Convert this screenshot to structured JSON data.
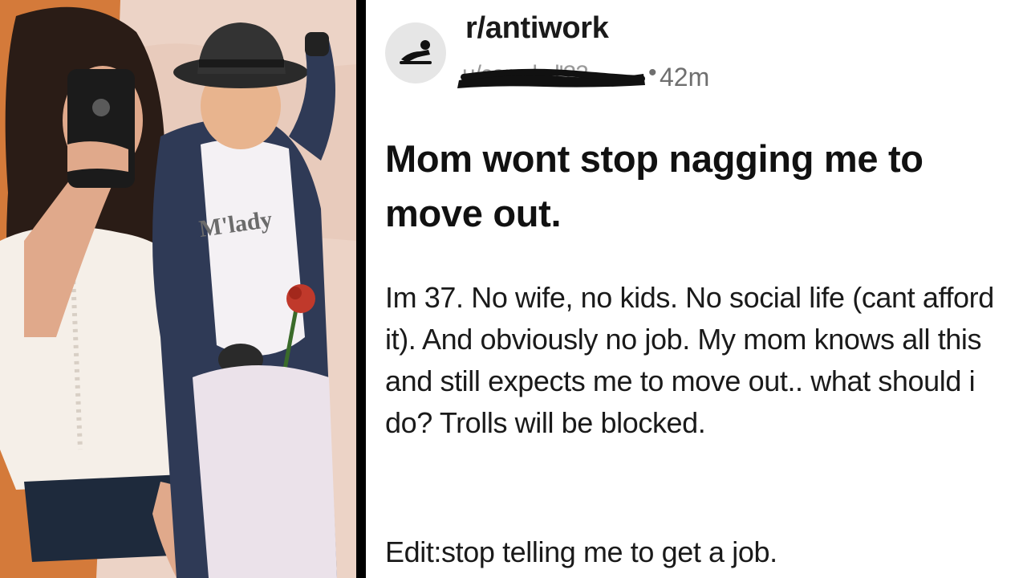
{
  "post": {
    "subreddit": "r/antiwork",
    "username": "u/carod...l'22",
    "separator": "•",
    "age": "42m",
    "title": "Mom wont stop nagging me to move out.",
    "body": "Im 37. No wife, no kids. No social life (cant afford it). And obviously no job. My mom knows all this and still expects me to move out.. what should i do? Trolls will be blocked.",
    "edit": "Edit:stop telling me to get a job."
  },
  "photo": {
    "shirt_text": "M'lady"
  },
  "icons": {
    "avatar": "reclining-figure-icon"
  }
}
